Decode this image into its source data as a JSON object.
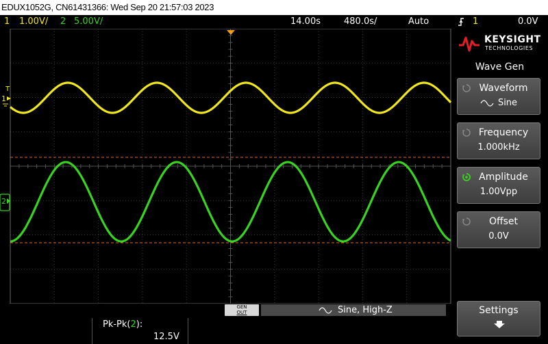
{
  "title": "EDUX1052G, CN61431366: Wed Sep 20 21:57:03 2023",
  "status": {
    "ch1_num": "1",
    "ch1_scale": "1.00V/",
    "ch2_num": "2",
    "ch2_scale": "5.00V/",
    "timebase": "14.00s",
    "delay": "480.0s/",
    "trigger_mode": "Auto",
    "trigger_icon": "trigger-edge-icon",
    "trigger_source": "1",
    "trigger_level": "0.0V"
  },
  "markers": {
    "ch1": "1",
    "ch2": "2",
    "trigger": "T"
  },
  "brand": {
    "name": "KEYSIGHT",
    "sub": "TECHNOLOGIES"
  },
  "menu": {
    "title": "Wave Gen",
    "softkeys": [
      {
        "title": "Waveform",
        "value": "Sine"
      },
      {
        "title": "Frequency",
        "value": "1.000kHz"
      },
      {
        "title": "Amplitude",
        "value": "1.00Vpp"
      },
      {
        "title": "Offset",
        "value": "0.0V"
      }
    ],
    "settings": "Settings"
  },
  "gen": {
    "badge_top": "GEN",
    "badge_bottom": "OUT",
    "info": "Sine, High-Z"
  },
  "measurement": {
    "label": "Pk-Pk(",
    "channel": "2",
    "label_end": "):",
    "value": "12.5V"
  },
  "colors": {
    "ch1": "#f0e81c",
    "ch2": "#38d420",
    "grid": "#3a3a3a",
    "cursor": "#e06a2a",
    "accent": "#f29a1a"
  }
}
